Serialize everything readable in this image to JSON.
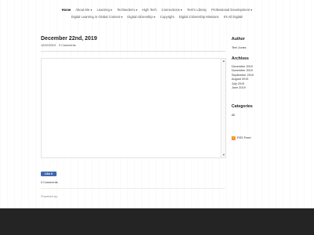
{
  "nav": {
    "row1": [
      "Home",
      "About Me ▾",
      "Learning ▾",
      "Techsederm ▾",
      "High Tech",
      "Connections ▾",
      "Terri's Library",
      "Professional Development ▾"
    ],
    "row2": [
      "Digital Learning in Global Context ▾",
      "Digital citizenship ▾",
      "Copyright",
      "Digital Citizenship Missions",
      "It's All Digital!"
    ]
  },
  "post": {
    "title": "December 22nd, 2019",
    "date": "12/22/2019",
    "comments_link": "0 Comments",
    "like_label": "Like 0",
    "comments_count": "0 Comments",
    "powered_by": "Powered by"
  },
  "sidebar": {
    "author_heading": "Author",
    "author_name": "Terri Jones",
    "archives_heading": "Archives",
    "archives": [
      "December 2019",
      "November 2019",
      "September 2019",
      "August 2019",
      "July 2019",
      "June 2019"
    ],
    "categories_heading": "Categories",
    "categories": [
      "All"
    ],
    "rss_label": "RSS Feed"
  },
  "colors": {
    "footer": "#242424",
    "facebook": "#4267b2",
    "rss": "#f7931e"
  }
}
